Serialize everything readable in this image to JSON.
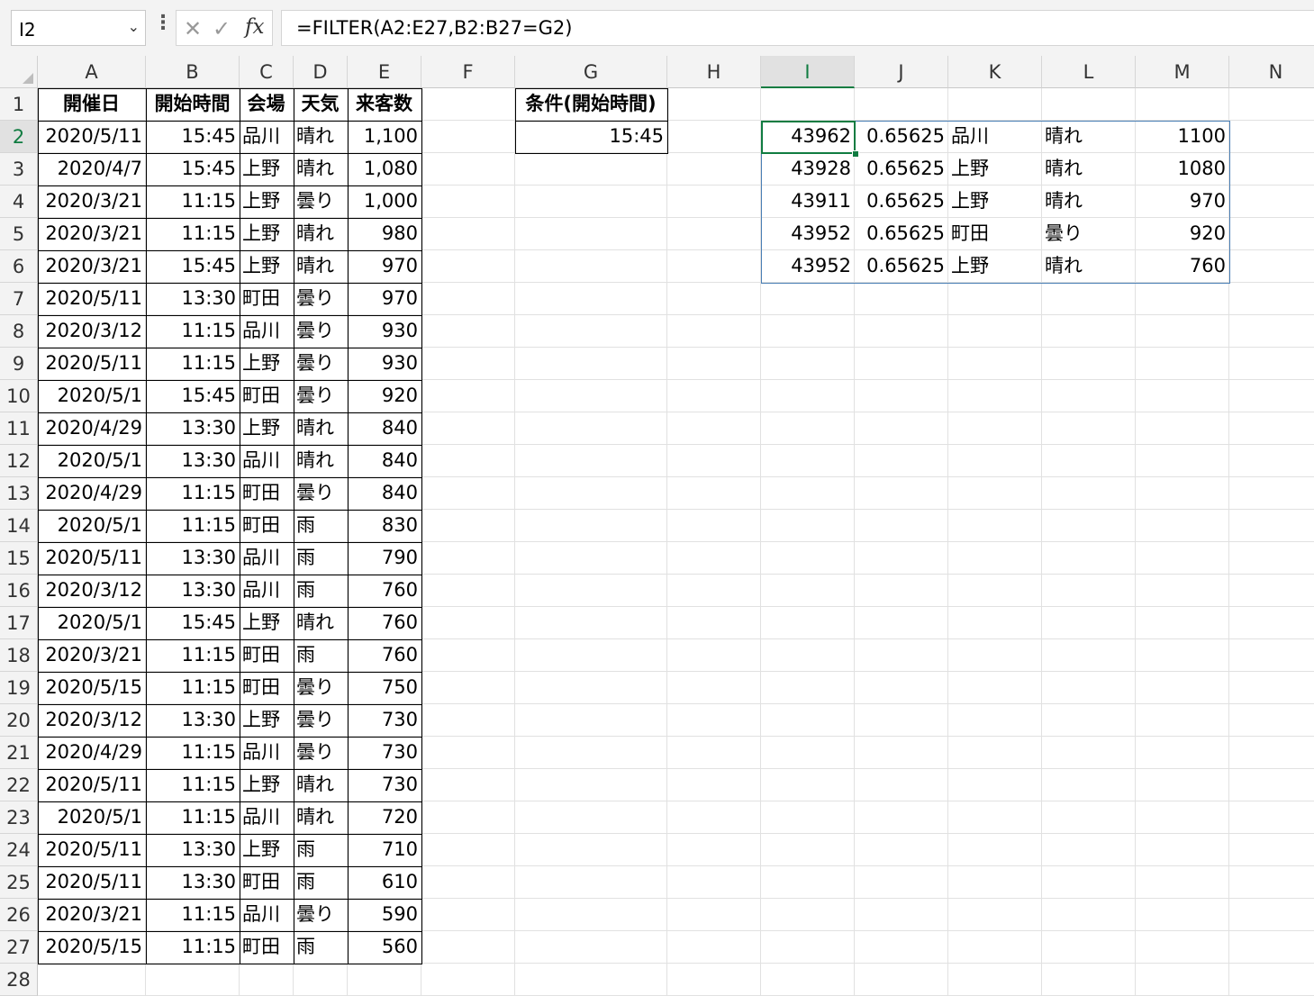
{
  "formula_bar": {
    "name_box": "I2",
    "formula": "=FILTER(A2:E27,B2:B27=G2)"
  },
  "columns": [
    "A",
    "B",
    "C",
    "D",
    "E",
    "F",
    "G",
    "H",
    "I",
    "J",
    "K",
    "L",
    "M",
    "N"
  ],
  "rows": [
    "1",
    "2",
    "3",
    "4",
    "5",
    "6",
    "7",
    "8",
    "9",
    "10",
    "11",
    "12",
    "13",
    "14",
    "15",
    "16",
    "17",
    "18",
    "19",
    "20",
    "21",
    "22",
    "23",
    "24",
    "25",
    "26",
    "27",
    "28"
  ],
  "table": {
    "headers": [
      "開催日",
      "開始時間",
      "会場",
      "天気",
      "来客数"
    ],
    "rows": [
      [
        "2020/5/11",
        "15:45",
        "品川",
        "晴れ",
        "1,100"
      ],
      [
        "2020/4/7",
        "15:45",
        "上野",
        "晴れ",
        "1,080"
      ],
      [
        "2020/3/21",
        "11:15",
        "上野",
        "曇り",
        "1,000"
      ],
      [
        "2020/3/21",
        "11:15",
        "上野",
        "晴れ",
        "980"
      ],
      [
        "2020/3/21",
        "15:45",
        "上野",
        "晴れ",
        "970"
      ],
      [
        "2020/5/11",
        "13:30",
        "町田",
        "曇り",
        "970"
      ],
      [
        "2020/3/12",
        "11:15",
        "品川",
        "曇り",
        "930"
      ],
      [
        "2020/5/11",
        "11:15",
        "上野",
        "曇り",
        "930"
      ],
      [
        "2020/5/1",
        "15:45",
        "町田",
        "曇り",
        "920"
      ],
      [
        "2020/4/29",
        "13:30",
        "上野",
        "晴れ",
        "840"
      ],
      [
        "2020/5/1",
        "13:30",
        "品川",
        "晴れ",
        "840"
      ],
      [
        "2020/4/29",
        "11:15",
        "町田",
        "曇り",
        "840"
      ],
      [
        "2020/5/1",
        "11:15",
        "町田",
        "雨",
        "830"
      ],
      [
        "2020/5/11",
        "13:30",
        "品川",
        "雨",
        "790"
      ],
      [
        "2020/3/12",
        "13:30",
        "品川",
        "雨",
        "760"
      ],
      [
        "2020/5/1",
        "15:45",
        "上野",
        "晴れ",
        "760"
      ],
      [
        "2020/3/21",
        "11:15",
        "町田",
        "雨",
        "760"
      ],
      [
        "2020/5/15",
        "11:15",
        "町田",
        "曇り",
        "750"
      ],
      [
        "2020/3/12",
        "13:30",
        "上野",
        "曇り",
        "730"
      ],
      [
        "2020/4/29",
        "11:15",
        "品川",
        "曇り",
        "730"
      ],
      [
        "2020/5/11",
        "11:15",
        "上野",
        "晴れ",
        "730"
      ],
      [
        "2020/5/1",
        "11:15",
        "品川",
        "晴れ",
        "720"
      ],
      [
        "2020/5/11",
        "13:30",
        "上野",
        "雨",
        "710"
      ],
      [
        "2020/5/11",
        "13:30",
        "町田",
        "雨",
        "610"
      ],
      [
        "2020/3/21",
        "11:15",
        "品川",
        "曇り",
        "590"
      ],
      [
        "2020/5/15",
        "11:15",
        "町田",
        "雨",
        "560"
      ]
    ]
  },
  "condition": {
    "header": "条件(開始時間)",
    "value": "15:45"
  },
  "spill_result": [
    [
      "43962",
      "0.65625",
      "品川",
      "晴れ",
      "1100"
    ],
    [
      "43928",
      "0.65625",
      "上野",
      "晴れ",
      "1080"
    ],
    [
      "43911",
      "0.65625",
      "上野",
      "晴れ",
      "970"
    ],
    [
      "43952",
      "0.65625",
      "町田",
      "曇り",
      "920"
    ],
    [
      "43952",
      "0.65625",
      "上野",
      "晴れ",
      "760"
    ]
  ],
  "colors": {
    "accent": "#107c41",
    "spill_border": "#4a7fb5",
    "header_bg": "#f3f3f3"
  }
}
